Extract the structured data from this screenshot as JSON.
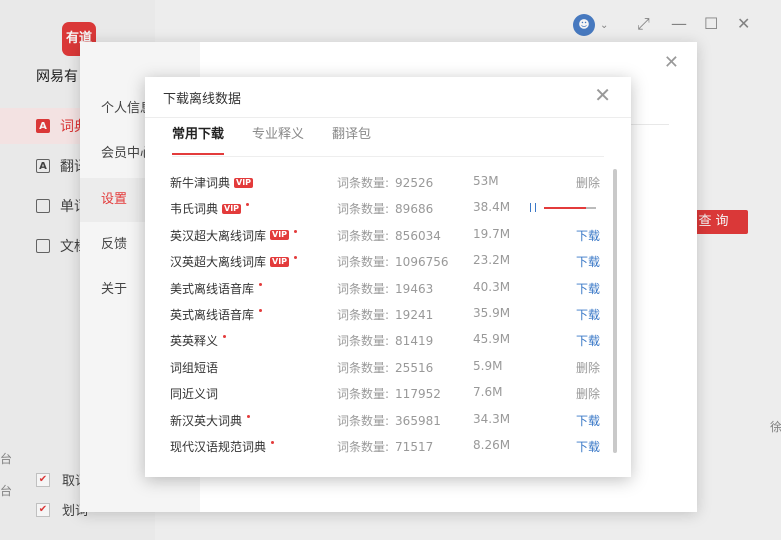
{
  "app": {
    "logo_text": "有道",
    "name": "网易有",
    "nav": [
      {
        "label": "词典",
        "icon": "dictionary-icon"
      },
      {
        "label": "翻译",
        "icon": "translate-icon"
      },
      {
        "label": "单词",
        "icon": "wordbook-icon"
      },
      {
        "label": "文档",
        "icon": "document-icon"
      }
    ],
    "checks": [
      {
        "label": "取词",
        "checked": true
      },
      {
        "label": "划词",
        "checked": true
      }
    ],
    "query_button": "查询",
    "edge_right": "徐",
    "edge_left_1": "台",
    "edge_left_2": "台"
  },
  "settings": {
    "items": [
      "个人信息",
      "会员中心",
      "设置",
      "反馈",
      "关于"
    ],
    "active_index": 2,
    "close_icon": "close-icon"
  },
  "dialog": {
    "title": "下载离线数据",
    "tabs": [
      "常用下载",
      "专业释义",
      "翻译包"
    ],
    "active_tab": 0,
    "count_label": "词条数量:",
    "rows": [
      {
        "name": "新牛津词典",
        "vip": true,
        "dot": false,
        "count": "92526",
        "size": "53M",
        "action": "删除",
        "state": "downloaded"
      },
      {
        "name": "韦氏词典",
        "vip": true,
        "dot": true,
        "count": "89686",
        "size": "38.4M",
        "action": "",
        "state": "downloading",
        "progress": 0.8
      },
      {
        "name": "英汉超大离线词库",
        "vip": true,
        "dot": true,
        "count": "856034",
        "size": "19.7M",
        "action": "下载",
        "state": "available"
      },
      {
        "name": "汉英超大离线词库",
        "vip": true,
        "dot": true,
        "count": "1096756",
        "size": "23.2M",
        "action": "下载",
        "state": "available"
      },
      {
        "name": "美式离线语音库",
        "vip": false,
        "dot": true,
        "count": "19463",
        "size": "40.3M",
        "action": "下载",
        "state": "available"
      },
      {
        "name": "英式离线语音库",
        "vip": false,
        "dot": true,
        "count": "19241",
        "size": "35.9M",
        "action": "下载",
        "state": "available"
      },
      {
        "name": "英英释义",
        "vip": false,
        "dot": true,
        "count": "81419",
        "size": "45.9M",
        "action": "下载",
        "state": "available"
      },
      {
        "name": "词组短语",
        "vip": false,
        "dot": false,
        "count": "25516",
        "size": "5.9M",
        "action": "删除",
        "state": "downloaded"
      },
      {
        "name": "同近义词",
        "vip": false,
        "dot": false,
        "count": "117952",
        "size": "7.6M",
        "action": "删除",
        "state": "downloaded"
      },
      {
        "name": "新汉英大词典",
        "vip": false,
        "dot": true,
        "count": "365981",
        "size": "34.3M",
        "action": "下载",
        "state": "available"
      },
      {
        "name": "现代汉语规范词典",
        "vip": false,
        "dot": true,
        "count": "71517",
        "size": "8.26M",
        "action": "下载",
        "state": "available"
      }
    ],
    "vip_label": "VIP"
  },
  "colors": {
    "accent": "#e33b3b",
    "link": "#3a78c7",
    "muted": "#999999"
  }
}
